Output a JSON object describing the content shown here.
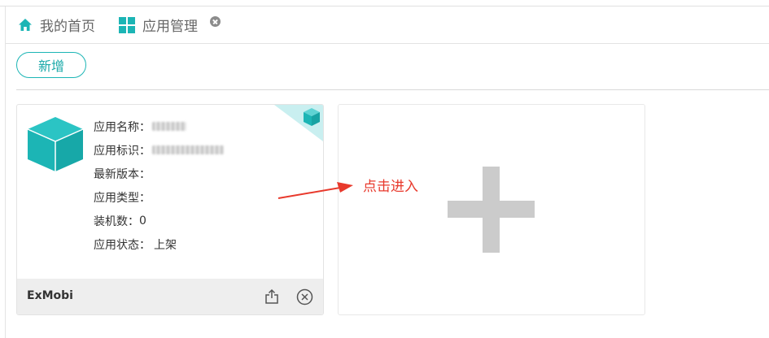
{
  "tabs": [
    {
      "label": "我的首页",
      "icon": "home-icon"
    },
    {
      "label": "应用管理",
      "icon": "grid-icon",
      "close_icon": "close-icon"
    }
  ],
  "toolbar": {
    "add_label": "新增"
  },
  "app_card": {
    "rows": [
      {
        "label": "应用名称：",
        "value": ""
      },
      {
        "label": "应用标识：",
        "value": ""
      },
      {
        "label": "最新版本：",
        "value": ""
      },
      {
        "label": "应用类型：",
        "value": ""
      },
      {
        "label": "装机数：",
        "value": "0"
      },
      {
        "label": "应用状态：",
        "value": "上架"
      }
    ],
    "footer_name": "ExMobi",
    "footer_icons": [
      "share-icon",
      "remove-icon"
    ],
    "icon": "cube-icon"
  },
  "new_card": {
    "icon": "plus-icon"
  },
  "annotation": {
    "text": "点击进入"
  },
  "colors": {
    "accent": "#1cb5b5",
    "annotation": "#e8392c",
    "plus": "#cbcbcb"
  }
}
